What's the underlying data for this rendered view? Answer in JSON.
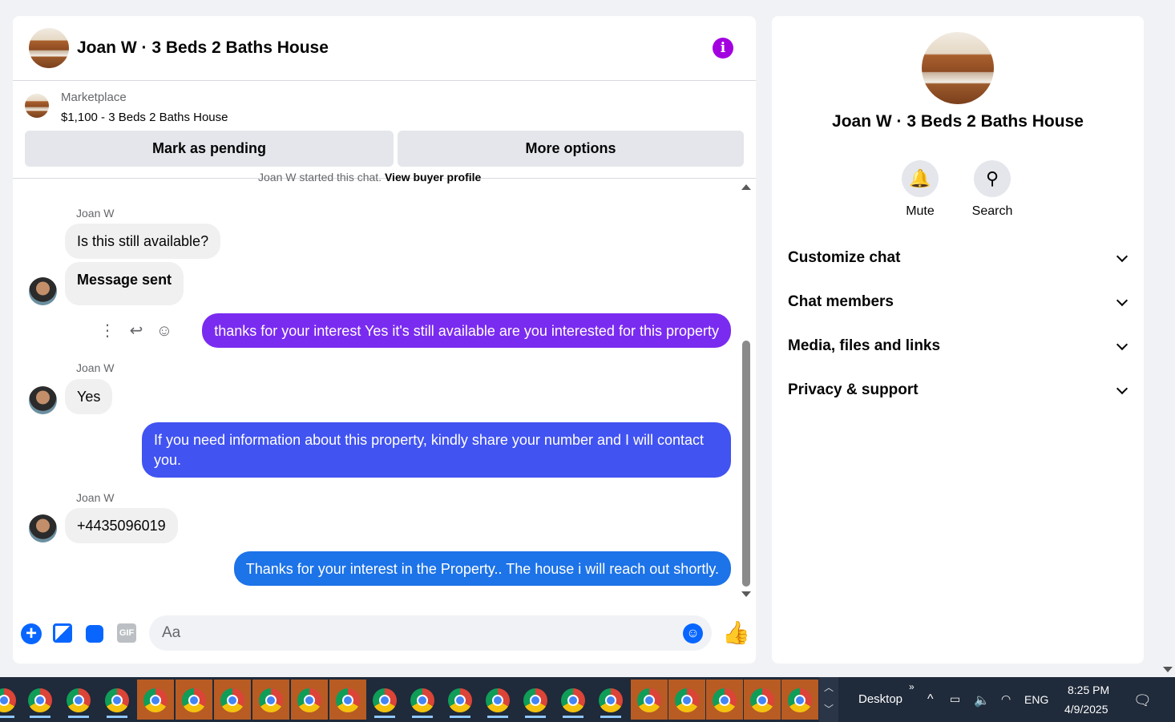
{
  "chat": {
    "title": "Joan W · 3 Beds 2 Baths House",
    "marketplace_label": "Marketplace",
    "listing": "$1,100 - 3 Beds 2 Baths House",
    "mark_pending": "Mark as pending",
    "more_options": "More options",
    "started_text": "Joan W started this chat.",
    "view_buyer_profile": "View buyer profile",
    "messages": [
      {
        "sender": "Joan W",
        "text": "Is this still available?"
      },
      {
        "text": "Message sent"
      },
      {
        "text": "thanks for your interest Yes it's still available are you interested for this property"
      },
      {
        "sender": "Joan W",
        "text": "Yes"
      },
      {
        "text": "If you need information about this property, kindly share  your number and I will contact you."
      },
      {
        "sender": "Joan W",
        "text": "+4435096019"
      },
      {
        "text": "Thanks for your interest in the Property.. The house i will reach  out shortly."
      }
    ],
    "composer_placeholder": "Aa",
    "gif_label": "GIF"
  },
  "info_panel": {
    "title": "Joan W · 3 Beds 2 Baths House",
    "mute_label": "Mute",
    "search_label": "Search",
    "sections": [
      "Customize chat",
      "Chat members",
      "Media, files and links",
      "Privacy & support"
    ]
  },
  "taskbar": {
    "desktop_label": "Desktop",
    "language": "ENG",
    "time": "8:25 PM",
    "date": "4/9/2025"
  },
  "colors": {
    "accent_purple": "#7a2bf0",
    "accent_indigo": "#4153f1",
    "accent_blue": "#1d73e8",
    "info_icon": "#a300e0"
  }
}
